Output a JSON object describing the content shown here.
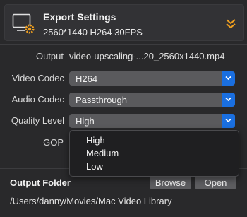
{
  "header": {
    "title": "Export Settings",
    "subtitle": "2560*1440 H264 30FPS",
    "icon": "monitor-gear-icon",
    "collapse_icon": "double-chevron-down-icon"
  },
  "output": {
    "label": "Output",
    "value": "video-upscaling-...20_2560x1440.mp4"
  },
  "video_codec": {
    "label": "Video Codec",
    "value": "H264"
  },
  "audio_codec": {
    "label": "Audio Codec",
    "value": "Passthrough"
  },
  "quality_level": {
    "label": "Quality Level",
    "value": "High",
    "options": [
      "High",
      "Medium",
      "Low"
    ]
  },
  "gop": {
    "label": "GOP"
  },
  "output_folder": {
    "title": "Output Folder",
    "browse_label": "Browse",
    "open_label": "Open",
    "path": "/Users/danny/Movies/Mac Video Library"
  },
  "colors": {
    "accent_blue": "#1a6fe0",
    "accent_orange": "#f0a020",
    "background": "#29292b"
  }
}
